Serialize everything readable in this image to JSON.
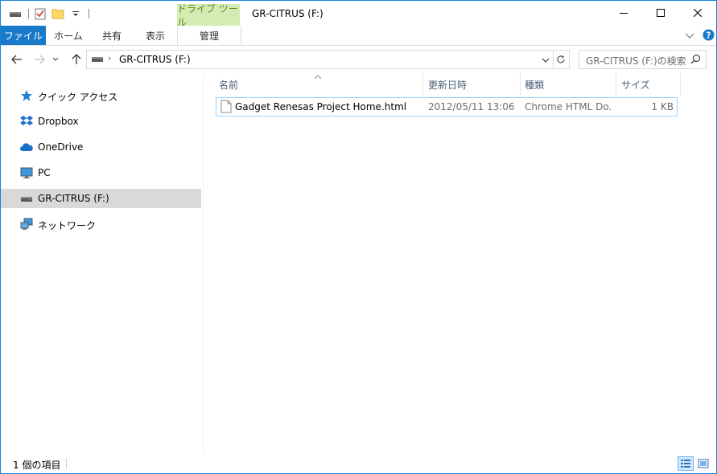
{
  "title_bar": {
    "window_title": "GR-CITRUS (F:)",
    "contextual_tab_group": "ドライブ ツール",
    "quick_access_icons": [
      "drive-icon",
      "properties-checkbox-icon",
      "new-folder-icon",
      "customize-qat-chevron-icon"
    ],
    "caption_buttons": [
      "minimize",
      "maximize",
      "close"
    ]
  },
  "ribbon": {
    "tabs": [
      {
        "label": "ファイル"
      },
      {
        "label": "ホーム"
      },
      {
        "label": "共有"
      },
      {
        "label": "表示"
      },
      {
        "label": "管理"
      }
    ]
  },
  "address": {
    "path": "GR-CITRUS (F:)",
    "search_placeholder": "GR-CITRUS (F:)の検索"
  },
  "nav_pane": {
    "items": [
      {
        "label": "クイック アクセス",
        "icon": "star-icon"
      },
      {
        "label": "Dropbox",
        "icon": "dropbox-icon"
      },
      {
        "label": "OneDrive",
        "icon": "cloud-icon"
      },
      {
        "label": "PC",
        "icon": "monitor-icon"
      },
      {
        "label": "GR-CITRUS (F:)",
        "icon": "drive-icon",
        "selected": true
      },
      {
        "label": "ネットワーク",
        "icon": "network-icon"
      }
    ]
  },
  "file_list": {
    "columns": [
      "名前",
      "更新日時",
      "種類",
      "サイズ"
    ],
    "sort_column": "名前",
    "rows": [
      {
        "name": "Gadget Renesas Project Home.html",
        "modified": "2012/05/11 13:06",
        "type": "Chrome HTML Do...",
        "size": "1 KB"
      }
    ]
  },
  "status_bar": {
    "item_count": "1 個の項目",
    "view_mode": "details"
  },
  "colors": {
    "file_tab": "#1979ca",
    "contextual_tab": "#d3ecb3",
    "contextual_tab_text": "#5d8a1d",
    "selection": "#d9d9d9",
    "row_border": "#99d1ff",
    "column_header_text": "#4c607a"
  }
}
